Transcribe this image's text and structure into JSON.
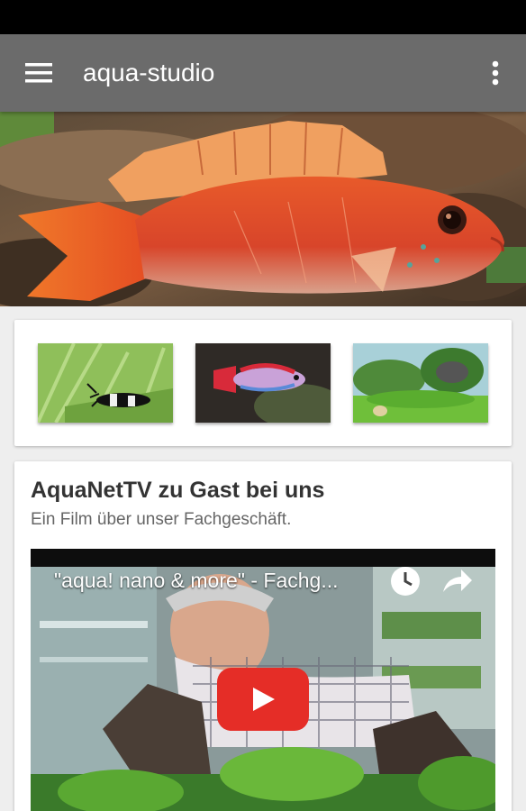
{
  "app_bar": {
    "title": "aqua-studio",
    "menu_icon": "hamburger-menu-icon",
    "overflow_icon": "more-vert-icon",
    "background_color": "#6b6b6b"
  },
  "hero": {
    "image": "red-cichlid-fish-photo"
  },
  "thumbnails": [
    {
      "image": "black-white-shrimp-photo"
    },
    {
      "image": "colorful-killifish-photo"
    },
    {
      "image": "planted-aquarium-photo"
    }
  ],
  "video_card": {
    "title": "AquaNetTV zu Gast bei uns",
    "subtitle": "Ein Film über unser Fachgeschäft.",
    "video_title": "\"aqua! nano & more\" - Fachg...",
    "icons": [
      "clock-icon",
      "share-icon",
      "play-icon"
    ],
    "play_button_color": "#e52d27"
  }
}
